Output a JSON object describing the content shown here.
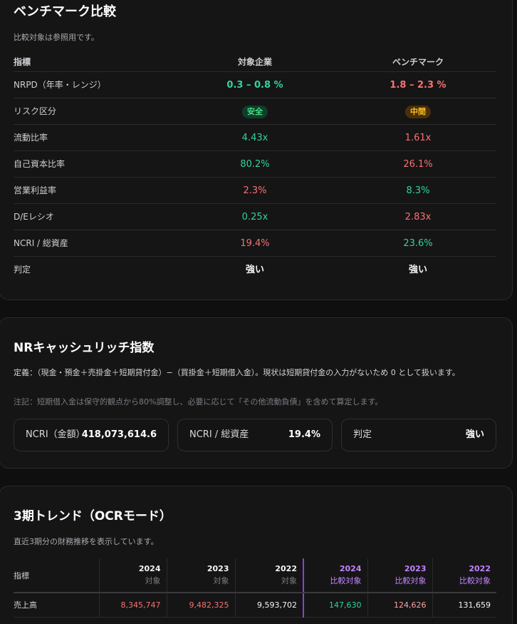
{
  "benchmark": {
    "title": "ベンチマーク比較",
    "subtitle": "比較対象は参照用です。",
    "headers": [
      "指標",
      "対象企業",
      "ベンチマーク"
    ],
    "rows": [
      {
        "label": "NRPD（年率・レンジ）",
        "target": "0.3 – 0.8 %",
        "bench": "1.8 – 2.3 %"
      },
      {
        "label": "リスク区分",
        "target": "安全",
        "bench": "中間"
      },
      {
        "label": "流動比率",
        "target": "4.43x",
        "bench": "1.61x"
      },
      {
        "label": "自己資本比率",
        "target": "80.2%",
        "bench": "26.1%"
      },
      {
        "label": "営業利益率",
        "target": "2.3%",
        "bench": "8.3%"
      },
      {
        "label": "D/Eレシオ",
        "target": "0.25x",
        "bench": "2.83x"
      },
      {
        "label": "NCRI / 総資産",
        "target": "19.4%",
        "bench": "23.6%"
      },
      {
        "label": "判定",
        "target": "強い",
        "bench": "強い"
      }
    ]
  },
  "ncri": {
    "title": "NRキャッシュリッチ指数",
    "definition": "定義：（現金・預金＋売掛金＋短期貸付金）−（買掛金＋短期借入金）。現状は短期貸付金の入力がないため 0 として扱います。",
    "note": "注記：短期借入金は保守的観点から80%調整し、必要に応じて「その他流動負債」を含めて算定します。",
    "kpis": [
      {
        "label": "NCRI（金額）",
        "value": "418,073,614.6"
      },
      {
        "label": "NCRI / 総資産",
        "value": "19.4%"
      },
      {
        "label": "判定",
        "value": "強い"
      }
    ]
  },
  "trend": {
    "title": "3期トレンド（OCRモード）",
    "subtitle": "直近3期分の財務推移を表示しています。",
    "first_header": "指標",
    "columns": [
      {
        "year": "2024",
        "sub": "対象"
      },
      {
        "year": "2023",
        "sub": "対象"
      },
      {
        "year": "2022",
        "sub": "対象"
      },
      {
        "year": "2024",
        "sub": "比較対象"
      },
      {
        "year": "2023",
        "sub": "比較対象"
      },
      {
        "year": "2022",
        "sub": "比較対象"
      }
    ],
    "rows": [
      {
        "label": "売上高",
        "values": [
          "8,345,747",
          "9,482,325",
          "9,593,702",
          "147,630",
          "124,626",
          "131,659"
        ]
      }
    ]
  }
}
